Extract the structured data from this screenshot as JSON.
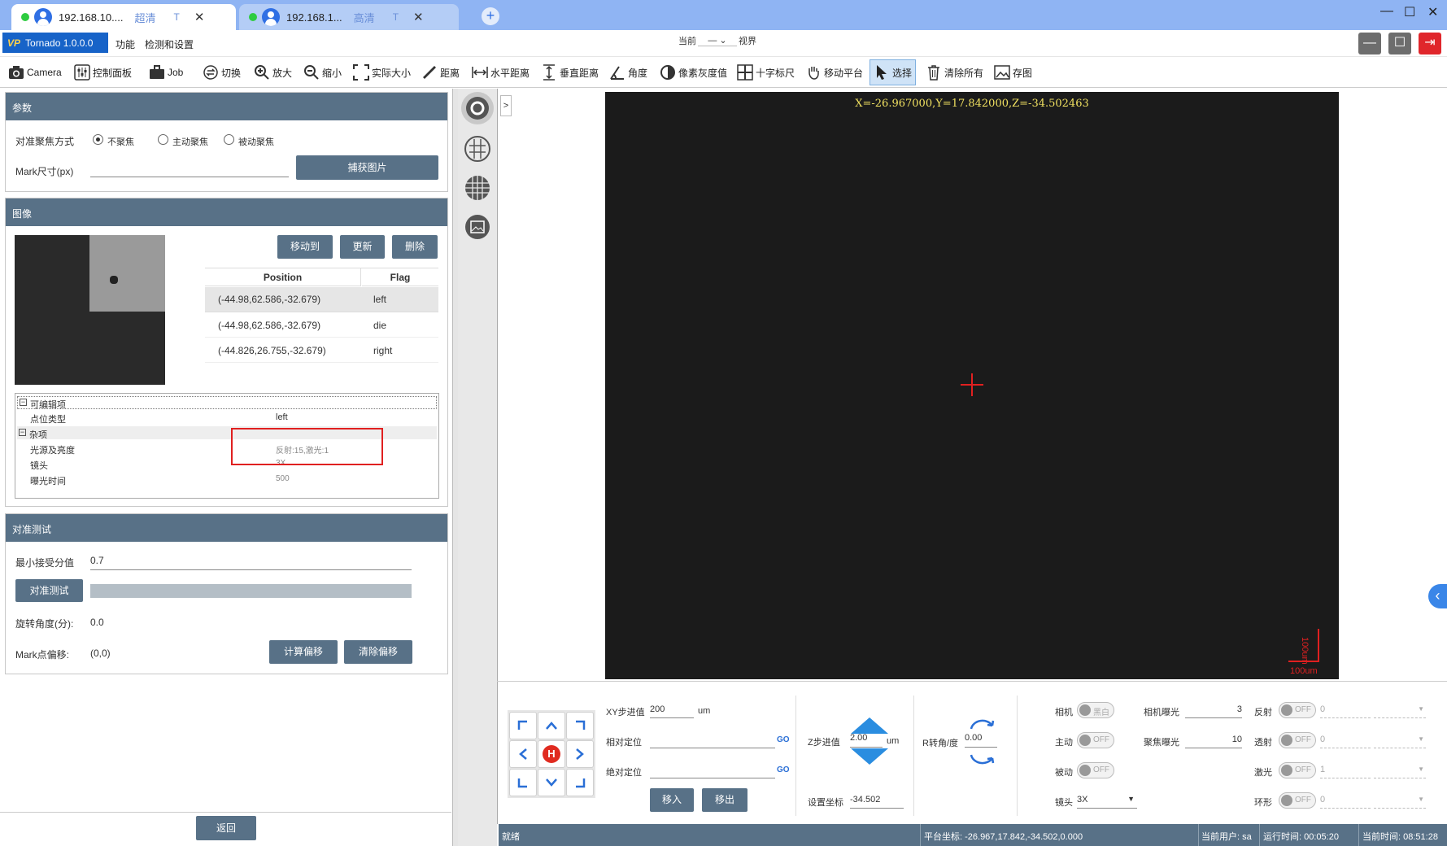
{
  "browser": {
    "tabs": [
      {
        "host": "192.168.10....",
        "quality": "超清",
        "t": "T",
        "close": "✕"
      },
      {
        "host": "192.168.1...",
        "quality": "高清",
        "t": "T",
        "close": "✕"
      }
    ],
    "new_tab": "+",
    "window_controls": [
      "—",
      "☐",
      "✕"
    ]
  },
  "app": {
    "logo_mark": "VP",
    "logo_text": "Tornado 1.0.0.0",
    "menus": [
      "功能",
      "检测和设置"
    ],
    "current_view_prefix": "当前",
    "current_view_value": "—",
    "current_view_suffix": "视界"
  },
  "toolbar": [
    {
      "label": "Camera",
      "icon": "camera-icon"
    },
    {
      "label": "控制面板",
      "icon": "sliders-icon"
    },
    {
      "label": "Job",
      "icon": "briefcase-icon"
    },
    {
      "label": "切换",
      "icon": "switch-icon"
    },
    {
      "label": "放大",
      "icon": "zoom-in-icon"
    },
    {
      "label": "缩小",
      "icon": "zoom-out-icon"
    },
    {
      "label": "实际大小",
      "icon": "fullsize-icon"
    },
    {
      "label": "距离",
      "icon": "ruler-icon"
    },
    {
      "label": "水平距离",
      "icon": "horizontal-distance-icon"
    },
    {
      "label": "垂直距离",
      "icon": "vertical-distance-icon"
    },
    {
      "label": "角度",
      "icon": "angle-icon"
    },
    {
      "label": "像素灰度值",
      "icon": "grayscale-icon"
    },
    {
      "label": "十字标尺",
      "icon": "crosshair-ruler-icon"
    },
    {
      "label": "移动平台",
      "icon": "hand-icon"
    },
    {
      "label": "选择",
      "icon": "cursor-icon"
    },
    {
      "label": "清除所有",
      "icon": "trash-icon"
    },
    {
      "label": "存图",
      "icon": "save-image-icon"
    }
  ],
  "params": {
    "title": "参数",
    "focus_label": "对准聚焦方式",
    "focus_options": [
      "不聚焦",
      "主动聚焦",
      "被动聚焦"
    ],
    "focus_selected": "不聚焦",
    "mark_size_label": "Mark尺寸(px)",
    "mark_size_value": "",
    "capture_button": "捕获图片"
  },
  "image": {
    "title": "图像",
    "move_to": "移动到",
    "update": "更新",
    "delete": "删除",
    "columns": [
      "Position",
      "Flag"
    ],
    "rows": [
      {
        "position": "(-44.98,62.586,-32.679)",
        "flag": "left"
      },
      {
        "position": "(-44.98,62.586,-32.679)",
        "flag": "die"
      },
      {
        "position": "(-44.826,26.755,-32.679)",
        "flag": "right"
      }
    ],
    "props": {
      "editable_group": "可编辑项",
      "point_type_label": "点位类型",
      "point_type_value": "left",
      "misc_group": "杂项",
      "light_label": "光源及亮度",
      "light_value": "反射:15,激光:1",
      "lens_label": "镜头",
      "lens_value": "3X",
      "exposure_label": "曝光时间",
      "exposure_value": "500"
    }
  },
  "align": {
    "title": "对准测试",
    "min_score_label": "最小接受分值",
    "min_score_value": "0.7",
    "test_button": "对准测试",
    "progress": 0,
    "rotation_label": "旋转角度(分):",
    "rotation_value": "0.0",
    "offset_label": "Mark点偏移:",
    "offset_value": "(0,0)",
    "calc_offset": "计算偏移",
    "clear_offset": "清除偏移"
  },
  "back_button": "返回",
  "collapse_toggle": ">",
  "viewer": {
    "coords": "X=-26.967000,Y=17.842000,Z=-34.502463",
    "scale_x": "100um",
    "scale_y": "100um",
    "side_toggle": "‹"
  },
  "controls": {
    "home": "H",
    "xy_step_label": "XY步进值",
    "xy_step_value": "200",
    "xy_unit": "um",
    "relative_label": "相对定位",
    "absolute_label": "绝对定位",
    "go": "GO",
    "move_in": "移入",
    "move_out": "移出",
    "z_step_label": "Z步进值",
    "z_step_value": "2.00",
    "z_unit": "um",
    "set_coord_label": "设置坐标",
    "set_coord_value": "-34.502",
    "r_label": "R转角/度",
    "r_value": "0.00",
    "camera_label": "相机",
    "camera_switch": "黑白",
    "active_label": "主动",
    "active_switch": "OFF",
    "passive_label": "被动",
    "passive_switch": "OFF",
    "lens_label": "镜头",
    "lens_value": "3X",
    "cam_exposure_label": "相机曝光",
    "cam_exposure_value": "3",
    "focus_exposure_label": "聚焦曝光",
    "focus_exposure_value": "10",
    "reflect_label": "反射",
    "reflect_switch": "OFF",
    "reflect_value": "0",
    "transmit_label": "透射",
    "transmit_switch": "OFF",
    "transmit_value": "0",
    "laser_label": "激光",
    "laser_switch": "OFF",
    "laser_value": "1",
    "ring_label": "环形",
    "ring_switch": "OFF",
    "ring_value": "0"
  },
  "status": {
    "state": "就绪",
    "platform": "平台坐标: -26.967,17.842,-34.502,0.000",
    "user": "当前用户: sa",
    "runtime": "运行时间: 00:05:20",
    "time": "当前时间: 08:51:28"
  }
}
